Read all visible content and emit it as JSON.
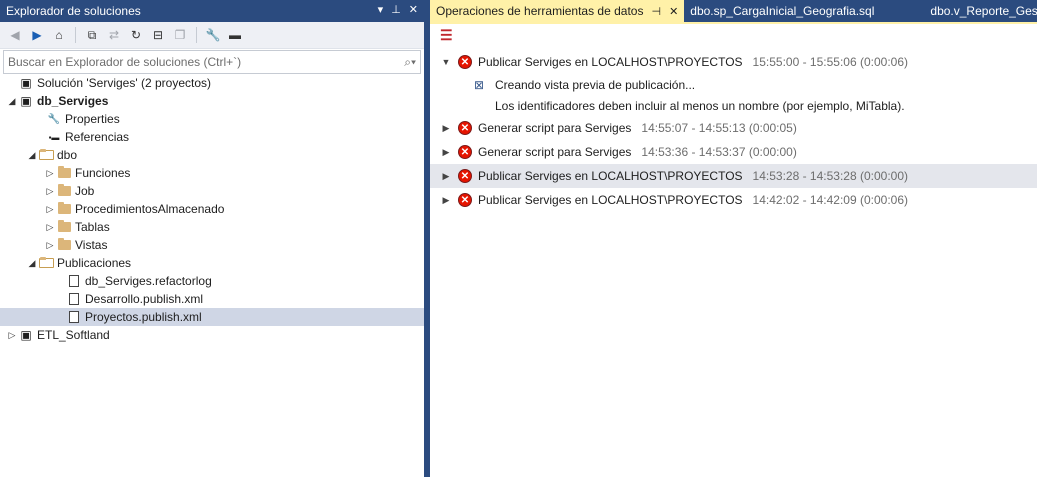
{
  "solution_explorer": {
    "title": "Explorador de soluciones",
    "title_controls": [
      "▾",
      "⊥",
      "✕"
    ],
    "search_placeholder": "Buscar en Explorador de soluciones (Ctrl+`)",
    "tree": [
      {
        "label": "Solución 'Serviges'  (2 proyectos)",
        "icon": "solution-icon",
        "expander": ""
      },
      {
        "label": "db_Serviges",
        "icon": "db-project-icon",
        "expander": "◢",
        "bold": true
      },
      {
        "label": "Properties",
        "icon": "wrench-icon",
        "expander": ""
      },
      {
        "label": "Referencias",
        "icon": "references-icon",
        "expander": ""
      },
      {
        "label": "dbo",
        "icon": "folder-open-icon",
        "expander": "◢"
      },
      {
        "label": "Funciones",
        "icon": "folder-icon",
        "expander": "▷"
      },
      {
        "label": "Job",
        "icon": "folder-icon",
        "expander": "▷"
      },
      {
        "label": "ProcedimientosAlmacenado",
        "icon": "folder-icon",
        "expander": "▷"
      },
      {
        "label": "Tablas",
        "icon": "folder-icon",
        "expander": "▷"
      },
      {
        "label": "Vistas",
        "icon": "folder-icon",
        "expander": "▷"
      },
      {
        "label": "Publicaciones",
        "icon": "folder-open-icon",
        "expander": "◢"
      },
      {
        "label": "db_Serviges.refactorlog",
        "icon": "file-icon",
        "expander": ""
      },
      {
        "label": "Desarrollo.publish.xml",
        "icon": "publish-file-icon",
        "expander": ""
      },
      {
        "label": "Proyectos.publish.xml",
        "icon": "publish-file-icon",
        "expander": "",
        "selected": true
      },
      {
        "label": "ETL_Softland",
        "icon": "etl-project-icon",
        "expander": "▷"
      }
    ]
  },
  "tabs": [
    {
      "label": "Operaciones de herramientas de datos",
      "active": true
    },
    {
      "label": "dbo.sp_CargaInicial_Geografia.sql"
    },
    {
      "label": "dbo.v_Reporte_Ges...cue"
    }
  ],
  "operations": [
    {
      "title": "Publicar Serviges en LOCALHOST\\PROYECTOS",
      "time": "15:55:00 - 15:55:06 (0:00:06)",
      "expanded": true,
      "details": [
        "Creando vista previa de publicación...",
        "Los identificadores deben incluir al menos un nombre (por ejemplo, MiTabla)."
      ]
    },
    {
      "title": "Generar script para Serviges",
      "time": "14:55:07 - 14:55:13 (0:00:05)"
    },
    {
      "title": "Generar script para Serviges",
      "time": "14:53:36 - 14:53:37 (0:00:00)"
    },
    {
      "title": "Publicar Serviges en LOCALHOST\\PROYECTOS",
      "time": "14:53:28 - 14:53:28 (0:00:00)",
      "highlighted": true
    },
    {
      "title": "Publicar Serviges en LOCALHOST\\PROYECTOS",
      "time": "14:42:02 - 14:42:09 (0:00:06)"
    }
  ],
  "colors": {
    "accent": "#2b4b7f",
    "active_tab": "#fff1a8",
    "error": "#e51400"
  }
}
